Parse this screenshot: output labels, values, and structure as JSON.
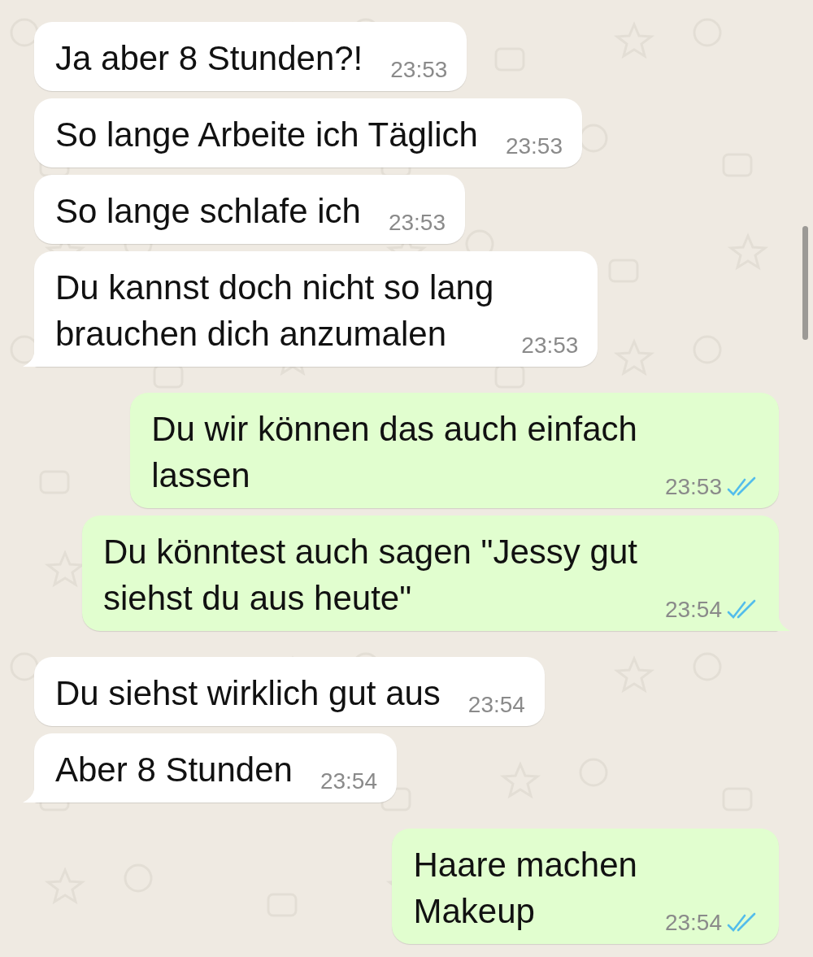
{
  "messages": [
    {
      "outgoing": false,
      "text": "Ja aber 8 Stunden?!",
      "time": "23:53",
      "tail": false
    },
    {
      "outgoing": false,
      "text": "So lange Arbeite ich Täglich",
      "time": "23:53",
      "tail": false
    },
    {
      "outgoing": false,
      "text": "So lange schlafe ich",
      "time": "23:53",
      "tail": false
    },
    {
      "outgoing": false,
      "text": "Du kannst doch nicht so lang\nbrauchen dich anzumalen",
      "time": "23:53",
      "tail": true
    },
    {
      "outgoing": true,
      "text": "Du wir können das auch einfach\nlassen",
      "time": "23:53",
      "tail": false,
      "read": true
    },
    {
      "outgoing": true,
      "text": "Du könntest auch sagen \"Jessy gut\nsiehst du aus heute\"",
      "time": "23:54",
      "tail": true,
      "read": true
    },
    {
      "outgoing": false,
      "text": "Du siehst wirklich gut aus",
      "time": "23:54",
      "tail": false
    },
    {
      "outgoing": false,
      "text": "Aber 8 Stunden",
      "time": "23:54",
      "tail": true
    },
    {
      "outgoing": true,
      "text": "Haare machen\nMakeup",
      "time": "23:54",
      "tail": false,
      "read": true
    }
  ]
}
